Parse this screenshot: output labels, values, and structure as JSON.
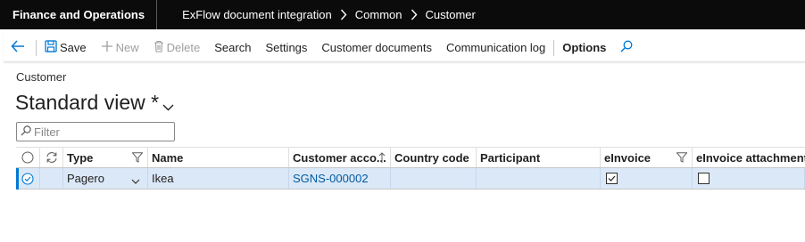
{
  "app": {
    "title": "Finance and Operations"
  },
  "breadcrumb": [
    "ExFlow document integration",
    "Common",
    "Customer"
  ],
  "toolbar": {
    "save": "Save",
    "new": "New",
    "delete": "Delete",
    "search": "Search",
    "settings": "Settings",
    "customer_documents": "Customer documents",
    "communication_log": "Communication log",
    "options": "Options"
  },
  "page": {
    "label": "Customer",
    "view_name": "Standard view *"
  },
  "filter": {
    "placeholder": "Filter"
  },
  "grid": {
    "columns": {
      "type": "Type",
      "name": "Name",
      "customer_account": "Customer acco...",
      "country_code": "Country code",
      "participant": "Participant",
      "einvoice": "eInvoice",
      "einvoice_attachment": "eInvoice attachment"
    },
    "rows": [
      {
        "type": "Pagero",
        "name": "Ikea",
        "customer_account": "SGNS-000002",
        "country_code": "",
        "participant": "",
        "einvoice": true,
        "einvoice_attachment": false
      }
    ]
  },
  "colors": {
    "accent": "#0078d4",
    "selected_row": "#dbe8f8",
    "topbar": "#0b0b0b",
    "link": "#005a9e"
  }
}
